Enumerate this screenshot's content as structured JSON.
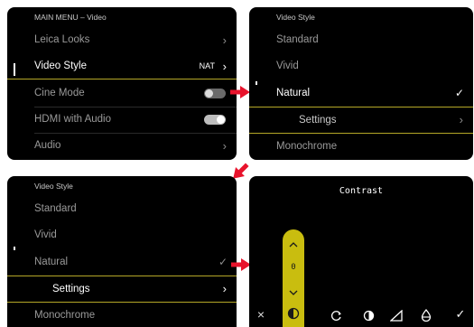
{
  "screen1": {
    "header": "MAIN MENU – Video",
    "items": [
      {
        "label": "Leica Looks"
      },
      {
        "label": "Video Style",
        "value": "NAT"
      },
      {
        "label": "Cine Mode"
      },
      {
        "label": "HDMI with Audio"
      },
      {
        "label": "Audio"
      }
    ],
    "cine_mode_on": false,
    "hdmi_audio_on": true
  },
  "screen2": {
    "header": "Video Style",
    "items": [
      {
        "label": "Standard"
      },
      {
        "label": "Vivid"
      },
      {
        "label": "Natural"
      },
      {
        "label": "Settings"
      },
      {
        "label": "Monochrome"
      }
    ]
  },
  "screen3": {
    "header": "Video Style",
    "items": [
      {
        "label": "Standard"
      },
      {
        "label": "Vivid"
      },
      {
        "label": "Natural"
      },
      {
        "label": "Settings"
      },
      {
        "label": "Monochrome"
      }
    ]
  },
  "screen4": {
    "title": "Contrast",
    "value": "0",
    "icons": [
      "close-icon",
      "contrast-icon",
      "rotate-icon",
      "half-circle-icon",
      "sharpness-icon",
      "saturation-icon",
      "check-icon"
    ]
  },
  "colors": {
    "accent": "#c9bd0f",
    "arrow": "#e8132c",
    "selection_line": "#b4a727"
  }
}
